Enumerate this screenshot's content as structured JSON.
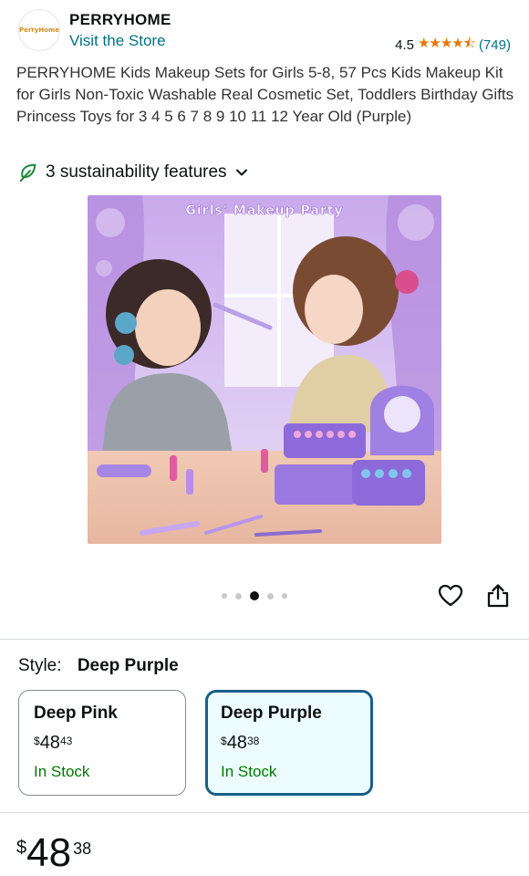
{
  "header": {
    "logo_text": "PerryHome",
    "brand": "PERRYHOME",
    "visit_link": "Visit the Store",
    "rating_value": "4.5",
    "stars": "★★★★⯪",
    "rating_count": "(749)"
  },
  "product": {
    "title": "PERRYHOME Kids Makeup Sets for Girls 5-8, 57 Pcs Kids Makeup Kit for Girls Non-Toxic Washable Real Cosmetic Set, Toddlers Birthday Gifts Princess Toys for 3 4 5 6 7 8 9 10 11 12 Year Old (Purple)",
    "sustainability": "3 sustainability features",
    "image_caption": "Girls' Makeup Party"
  },
  "carousel": {
    "count": 5,
    "active_index": 2
  },
  "style": {
    "label": "Style:",
    "selected": "Deep Purple",
    "options": [
      {
        "name": "Deep Pink",
        "currency": "$",
        "whole": "48",
        "cents": "43",
        "stock": "In Stock"
      },
      {
        "name": "Deep Purple",
        "currency": "$",
        "whole": "48",
        "cents": "38",
        "stock": "In Stock"
      }
    ]
  },
  "price": {
    "currency": "$",
    "whole": "48",
    "cents": "38"
  },
  "colors": {
    "link": "#007185",
    "star": "#e77600",
    "in_stock": "#007600",
    "selected_border": "#1a5f88",
    "selected_bg": "#edfdff"
  },
  "icons": [
    "leaf-icon",
    "chevron-down-icon",
    "heart-icon",
    "share-icon"
  ]
}
